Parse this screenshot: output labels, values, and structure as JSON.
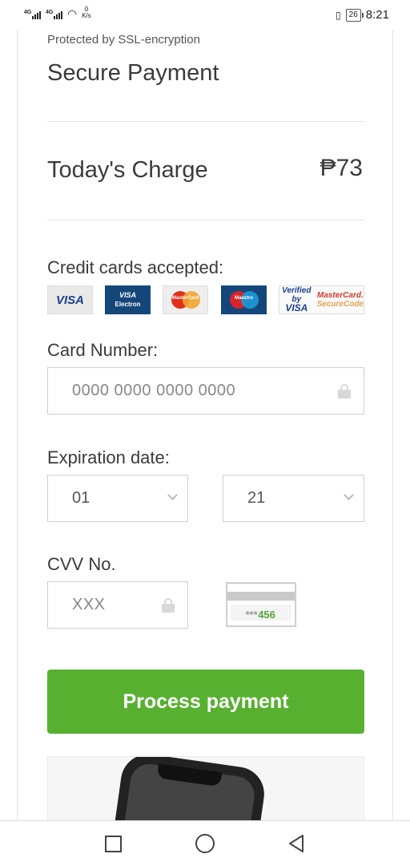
{
  "status_bar": {
    "network_1": "4G",
    "network_2": "4G",
    "speed_value": "0",
    "speed_unit": "K/s",
    "battery": "26",
    "time": "8:21"
  },
  "header": {
    "ssl_note": "Protected by SSL-encryption",
    "title": "Secure Payment"
  },
  "charge": {
    "label": "Today's Charge",
    "amount": "₱73"
  },
  "cards": {
    "label": "Credit cards accepted:",
    "visa": "VISA",
    "electron_top": "VISA",
    "electron_bottom": "Electron",
    "mastercard": "MasterCard",
    "maestro": "Maestro",
    "verified_top": "Verified by",
    "verified_bottom": "VISA",
    "securecode_top": "MasterCard.",
    "securecode_bottom": "SecureCode"
  },
  "card_number": {
    "label": "Card Number:",
    "placeholder": "0000 0000 0000 0000"
  },
  "expiration": {
    "label": "Expiration date:",
    "month": "01",
    "year": "21"
  },
  "cvv": {
    "label": "CVV No.",
    "placeholder": "XXX",
    "example_masked": "***",
    "example_digits": "456"
  },
  "actions": {
    "process_label": "Process payment"
  },
  "colors": {
    "accent_green": "#58b030",
    "visa_blue": "#15467a"
  }
}
